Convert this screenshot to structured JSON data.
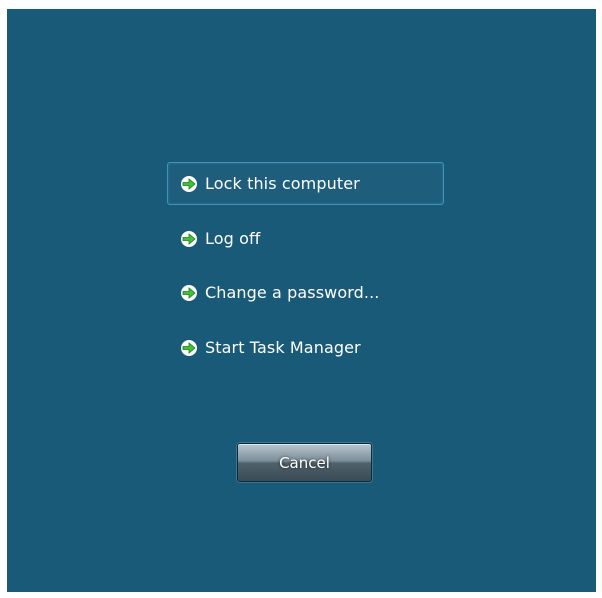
{
  "options": [
    {
      "label": "Lock this computer",
      "icon": "green-arrow-icon",
      "selected": true
    },
    {
      "label": "Log off",
      "icon": "green-arrow-icon",
      "selected": false
    },
    {
      "label": "Change a password...",
      "icon": "green-arrow-icon",
      "selected": false
    },
    {
      "label": "Start Task Manager",
      "icon": "green-arrow-icon",
      "selected": false
    }
  ],
  "cancel_label": "Cancel",
  "colors": {
    "background": "#1a5a79",
    "selection_border": "#3f94bd",
    "arrow_green": "#3fc23a"
  }
}
